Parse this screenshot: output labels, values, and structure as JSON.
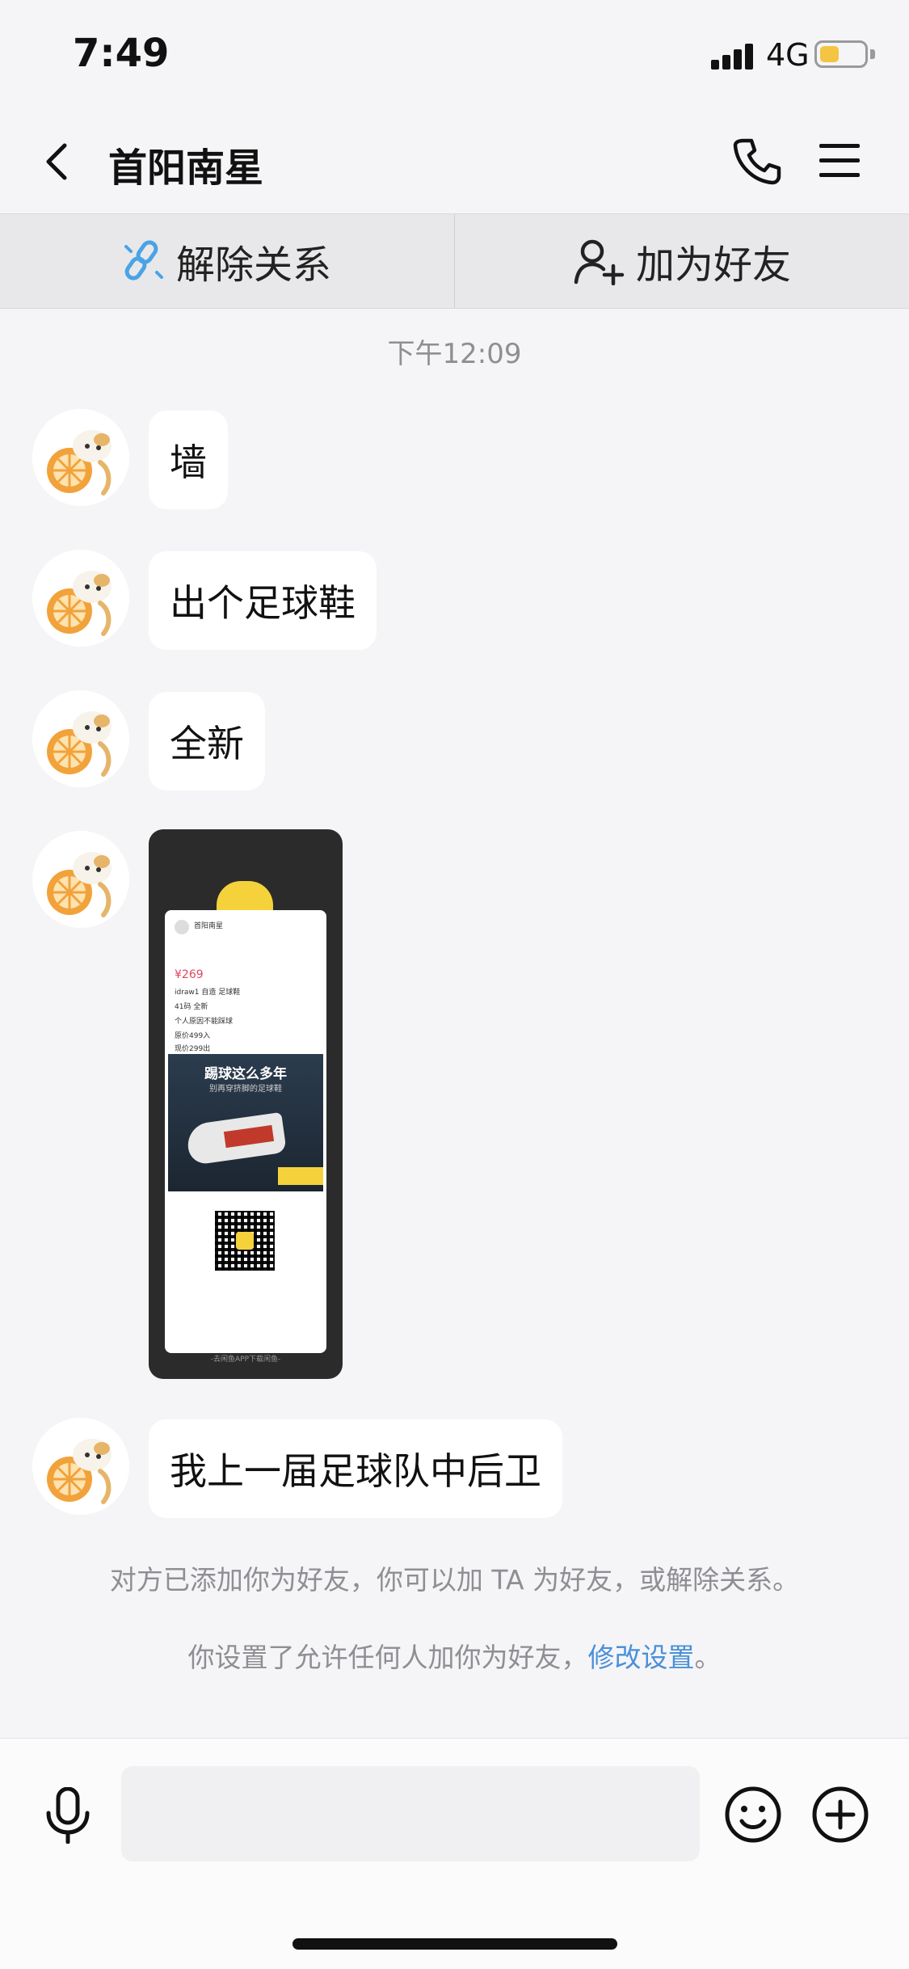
{
  "status_bar": {
    "time": "7:49",
    "network": "4G",
    "battery_level": 0.45
  },
  "nav": {
    "title": "首阳南星"
  },
  "actions": {
    "unlink_label": "解除关系",
    "add_friend_label": "加为好友"
  },
  "chat": {
    "time_divider": "下午12:09",
    "messages": [
      {
        "text": "墙"
      },
      {
        "text": "出个足球鞋"
      },
      {
        "text": "全新"
      },
      {
        "type": "image"
      },
      {
        "text": "我上一届足球队中后卫"
      }
    ],
    "image_card": {
      "seller": "首阳南星",
      "price": "¥269",
      "lines": [
        "idraw1 自造 足球鞋",
        "41码 全新",
        "个人原因不能踩球",
        "原价499入",
        "现价299出"
      ],
      "photo_title": "踢球这么多年",
      "photo_subtitle": "别再穿挤脚的足球鞋",
      "footer": "-去闲鱼APP下载闲鱼-"
    },
    "notices": {
      "added_text": "对方已添加你为好友，你可以加 TA 为好友，或解除关系。",
      "settings_prefix": "你设置了允许任何人加你为好友，",
      "settings_link": "修改设置",
      "settings_suffix": "。"
    }
  },
  "input": {
    "placeholder": ""
  },
  "colors": {
    "link": "#4a90d9",
    "battery": "#f4c542",
    "background": "#f5f5f7"
  }
}
